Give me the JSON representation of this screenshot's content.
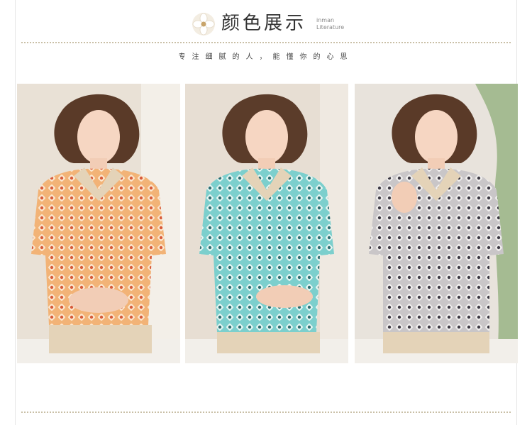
{
  "header": {
    "title": "颜色展示",
    "en_line1": "inman",
    "en_line2": "Literature"
  },
  "subtitle": "专注细腻的人，能懂你的心思",
  "colors": {
    "accent": "#c9bfa6",
    "variants": [
      "#e89a4e",
      "#6cc3c2",
      "#8a8a8e"
    ]
  },
  "photos": [
    {
      "name": "orange-print-model",
      "color": "#e89a4e"
    },
    {
      "name": "teal-print-model",
      "color": "#6cc3c2"
    },
    {
      "name": "grey-print-model",
      "color": "#8a8a8e"
    }
  ]
}
